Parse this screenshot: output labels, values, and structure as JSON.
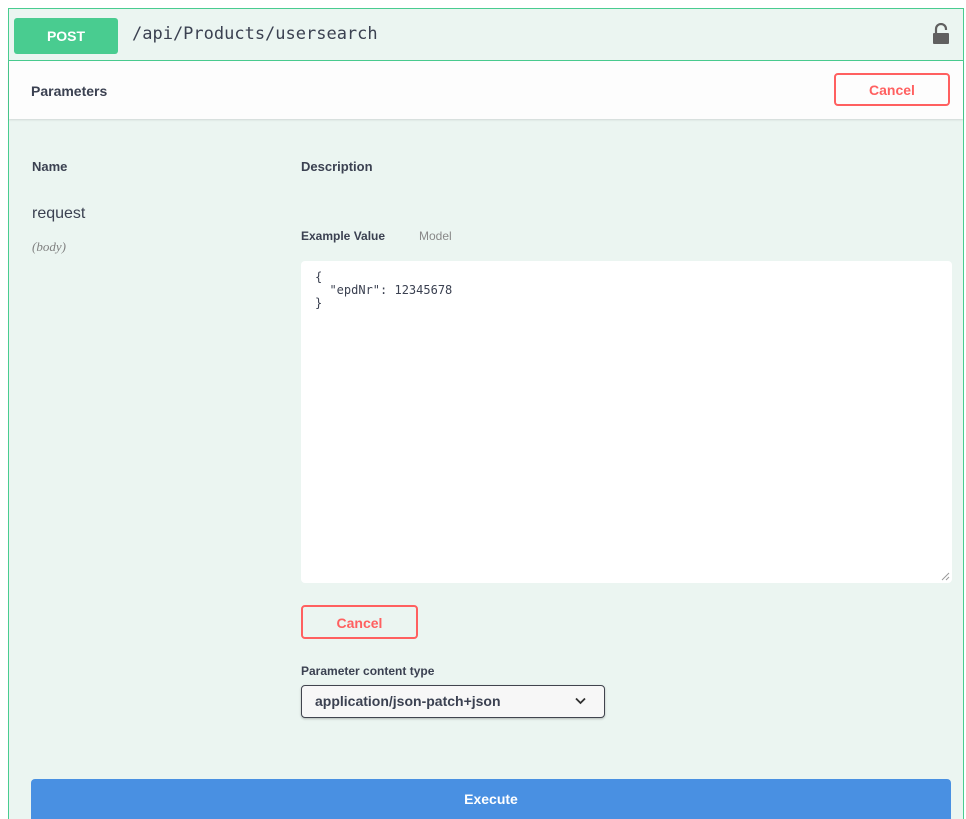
{
  "summary": {
    "method": "POST",
    "path": "/api/Products/usersearch"
  },
  "parameters": {
    "title": "Parameters",
    "cancel_label": "Cancel",
    "columns": {
      "name": "Name",
      "description": "Description"
    },
    "param": {
      "name": "request",
      "in": "(body)"
    },
    "tabs": {
      "example": "Example Value",
      "model": "Model"
    },
    "editor_value": "{\n  \"epdNr\": 12345678\n}",
    "body_cancel_label": "Cancel",
    "content_type_label": "Parameter content type",
    "content_type_value": "application/json-patch+json"
  },
  "execute_label": "Execute",
  "colors": {
    "post_green": "#49cc90",
    "block_bg": "#ebf5f1",
    "cancel_red": "#ff6060",
    "execute_blue": "#4990e2"
  },
  "icons": {
    "lock": "lock-icon",
    "chevron": "chevron-down-icon",
    "resize": "resize-handle-icon"
  }
}
